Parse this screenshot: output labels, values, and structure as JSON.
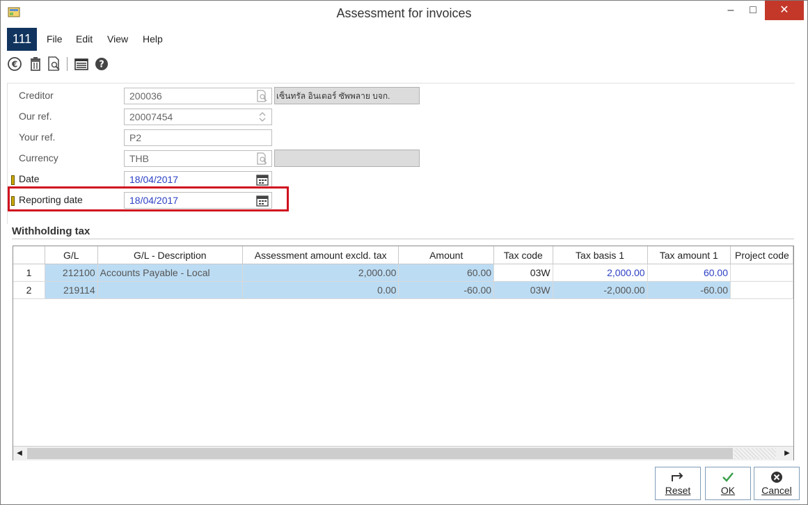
{
  "window": {
    "title": "Assessment for invoices",
    "minimize": "–",
    "maximize": "□",
    "close": "✕"
  },
  "menubar": {
    "company": "111",
    "items": [
      "File",
      "Edit",
      "View",
      "Help"
    ]
  },
  "toolbar": {
    "icons": [
      "euro-icon",
      "trash-icon",
      "document-search-icon",
      "list-icon",
      "help-icon"
    ]
  },
  "form": {
    "creditor": {
      "label": "Creditor",
      "value": "200036",
      "description": "เซ็นทรัล อินเตอร์ ซัพพลาย บจก."
    },
    "our_ref": {
      "label": "Our ref.",
      "value": "20007454"
    },
    "your_ref": {
      "label": "Your ref.",
      "value": "P2"
    },
    "currency": {
      "label": "Currency",
      "value": "THB",
      "description": ""
    },
    "date": {
      "label": "Date",
      "value": "18/04/2017"
    },
    "reporting_date": {
      "label": "Reporting date",
      "value": "18/04/2017"
    }
  },
  "section": {
    "title": "Withholding tax"
  },
  "table": {
    "columns": [
      "",
      "G/L",
      "G/L - Description",
      "Assessment amount excld. tax",
      "Amount",
      "Tax code",
      "Tax basis 1",
      "Tax amount 1",
      "Project code"
    ],
    "rows": [
      {
        "num": "1",
        "gl": "212100",
        "description": "Accounts Payable - Local",
        "assessment": "2,000.00",
        "amount": "60.00",
        "tax_code": "03W",
        "tax_basis": "2,000.00",
        "tax_amount": "60.00",
        "project": ""
      },
      {
        "num": "2",
        "gl": "219114",
        "description": "",
        "assessment": "0.00",
        "amount": "-60.00",
        "tax_code": "03W",
        "tax_basis": "-2,000.00",
        "tax_amount": "-60.00",
        "project": ""
      }
    ]
  },
  "buttons": {
    "reset": "Reset",
    "ok": "OK",
    "cancel": "Cancel"
  },
  "colors": {
    "accent": "#10345e",
    "highlight": "#d0101e",
    "selected_row": "#bcdcf3",
    "link_blue": "#2b3fc4"
  }
}
